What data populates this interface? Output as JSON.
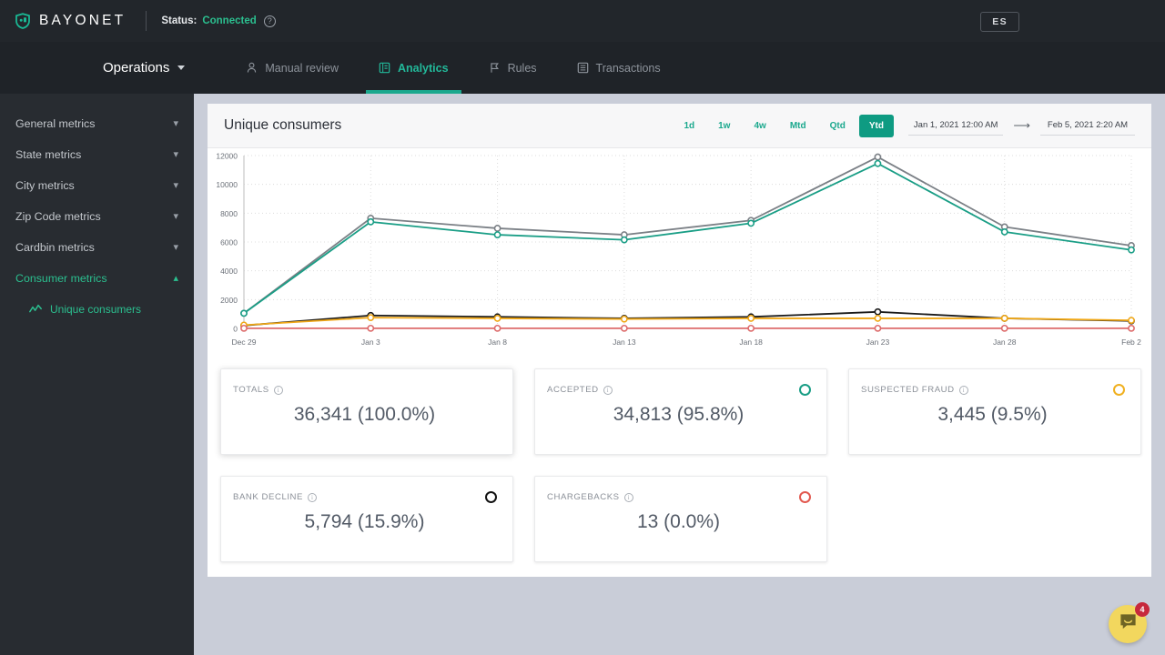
{
  "topbar": {
    "brand": "BAYONET",
    "brand_icon": "shield-logo-icon",
    "status_label": "Status:",
    "status_value": "Connected",
    "help_icon": "question-mark-icon",
    "language": "ES"
  },
  "nav": {
    "operations_label": "Operations",
    "tabs": [
      {
        "label": "Manual review",
        "icon": "person-icon",
        "active": false
      },
      {
        "label": "Analytics",
        "icon": "chart-panel-icon",
        "active": true
      },
      {
        "label": "Rules",
        "icon": "flag-icon",
        "active": false
      },
      {
        "label": "Transactions",
        "icon": "list-icon",
        "active": false
      }
    ]
  },
  "sidebar": {
    "items": [
      {
        "label": "General metrics",
        "open": false
      },
      {
        "label": "State metrics",
        "open": false
      },
      {
        "label": "City metrics",
        "open": false
      },
      {
        "label": "Zip Code metrics",
        "open": false
      },
      {
        "label": "Cardbin metrics",
        "open": false
      },
      {
        "label": "Consumer metrics",
        "open": true
      }
    ],
    "sub_item": {
      "label": "Unique consumers",
      "icon": "sparkline-icon"
    }
  },
  "card": {
    "title": "Unique consumers",
    "ranges": [
      {
        "label": "1d",
        "active": false
      },
      {
        "label": "1w",
        "active": false
      },
      {
        "label": "4w",
        "active": false
      },
      {
        "label": "Mtd",
        "active": false
      },
      {
        "label": "Qtd",
        "active": false
      },
      {
        "label": "Ytd",
        "active": true
      }
    ],
    "date_from": "Jan 1, 2021 12:00 AM",
    "date_to": "Feb 5, 2021 2:20 AM",
    "arrow_icon": "right-arrow-icon"
  },
  "chart_data": {
    "type": "line",
    "title": "Unique consumers",
    "xlabel": "",
    "ylabel": "",
    "ylim": [
      0,
      12000
    ],
    "yticks": [
      0,
      2000,
      4000,
      6000,
      8000,
      10000,
      12000
    ],
    "grid": true,
    "legend_position": "none",
    "categories": [
      "Dec 29",
      "Jan 3",
      "Jan 8",
      "Jan 13",
      "Jan 18",
      "Jan 23",
      "Jan 28",
      "Feb 2"
    ],
    "series": [
      {
        "name": "Totals",
        "color": "#7b8086",
        "values": [
          1050,
          7650,
          6950,
          6500,
          7500,
          11900,
          7050,
          5750
        ]
      },
      {
        "name": "Accepted",
        "color": "#1a9e86",
        "values": [
          1050,
          7400,
          6500,
          6150,
          7300,
          11450,
          6700,
          5450
        ]
      },
      {
        "name": "Bank decline",
        "color": "#1a1a1a",
        "values": [
          200,
          900,
          800,
          700,
          800,
          1150,
          700,
          520
        ]
      },
      {
        "name": "Suspected fraud",
        "color": "#f0a818",
        "values": [
          230,
          750,
          700,
          650,
          700,
          700,
          700,
          560
        ]
      },
      {
        "name": "Chargebacks",
        "color": "#dd6b6b",
        "values": [
          10,
          10,
          10,
          10,
          10,
          10,
          10,
          10
        ]
      }
    ]
  },
  "stats": [
    {
      "label": "TOTALS",
      "value": "36,341 (100.0%)",
      "dot": false,
      "dot_color": "#7b8086",
      "highlight": true
    },
    {
      "label": "ACCEPTED",
      "value": "34,813 (95.8%)",
      "dot": true,
      "dot_color": "#1a9e86",
      "highlight": false
    },
    {
      "label": "SUSPECTED FRAUD",
      "value": "3,445 (9.5%)",
      "dot": true,
      "dot_color": "#f0b020",
      "highlight": false
    },
    {
      "label": "BANK DECLINE",
      "value": "5,794 (15.9%)",
      "dot": true,
      "dot_color": "#121212",
      "highlight": false
    },
    {
      "label": "CHARGEBACKS",
      "value": "13 (0.0%)",
      "dot": true,
      "dot_color": "#e2594f",
      "highlight": false
    }
  ],
  "chat": {
    "icon": "chat-bubble-icon",
    "badge": "4"
  }
}
